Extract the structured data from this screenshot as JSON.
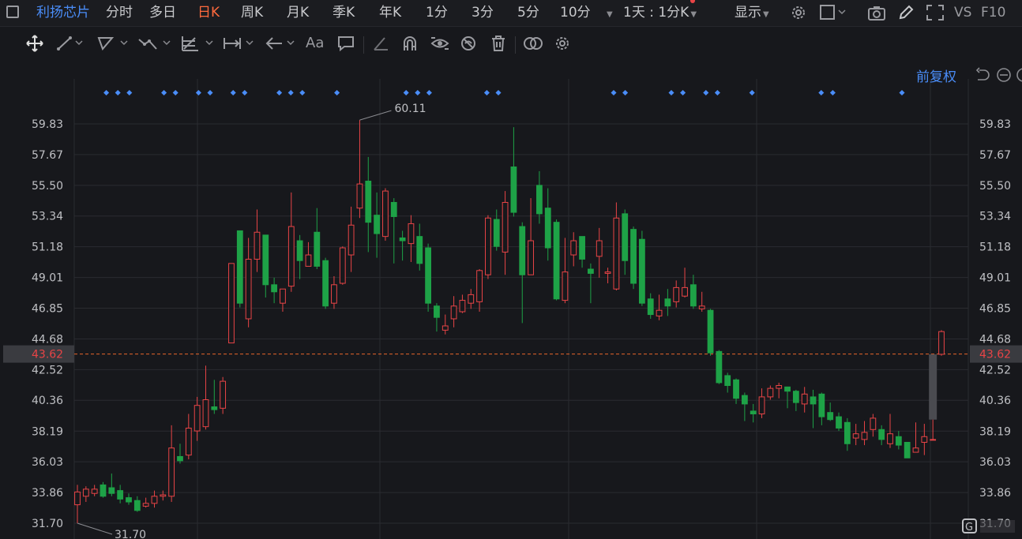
{
  "header": {
    "stock_name": "利扬芯片",
    "periods": [
      {
        "label": "分时",
        "active": false
      },
      {
        "label": "多日",
        "active": false
      },
      {
        "label": "日K",
        "active": true
      },
      {
        "label": "周K",
        "active": false
      },
      {
        "label": "月K",
        "active": false
      },
      {
        "label": "季K",
        "active": false
      },
      {
        "label": "年K",
        "active": false
      },
      {
        "label": "1分",
        "active": false
      },
      {
        "label": "3分",
        "active": false
      },
      {
        "label": "5分",
        "active": false
      },
      {
        "label": "10分",
        "active": false
      }
    ],
    "interval_select": "1天 : 1分K",
    "display_label": "显示",
    "vs_label": "VS",
    "f10_label": "F10"
  },
  "toolbar": {
    "text_tool_label": "Aa",
    "icons": [
      "move-icon",
      "line-icon",
      "polyline-icon",
      "wave-icon",
      "fibonacci-icon",
      "measure-icon",
      "arrow-icon",
      "text-icon",
      "comment-icon",
      "ruler-icon",
      "magnet-icon",
      "eye-icon",
      "hide-icon",
      "trash-icon",
      "link-icon",
      "gear-icon"
    ]
  },
  "chart_data": {
    "type": "candlestick",
    "adjust_mode": "前复权",
    "y_ticks": [
      "59.83",
      "57.67",
      "55.50",
      "53.34",
      "51.18",
      "49.01",
      "46.85",
      "44.68",
      "43.62",
      "42.52",
      "40.36",
      "38.19",
      "36.03",
      "33.86",
      "31.70"
    ],
    "last_price": "43.62",
    "high_label": "60.11",
    "low_label": "31.70",
    "ylim": [
      31.7,
      59.83
    ],
    "colors": {
      "up": "#e84446",
      "down": "#1ea247",
      "grid": "#2a2b30",
      "bg": "#17181c",
      "marker": "#4a8df8",
      "last_price": "#e8642b"
    },
    "candles": [
      [
        33.0,
        33.9,
        34.4,
        31.7
      ],
      [
        33.6,
        34.1,
        34.3,
        33.2
      ],
      [
        33.8,
        34.1,
        34.4,
        33.6
      ],
      [
        34.4,
        33.6,
        34.6,
        33.5
      ],
      [
        34.2,
        33.8,
        35.2,
        33.6
      ],
      [
        34.0,
        33.4,
        34.4,
        33.1
      ],
      [
        33.5,
        33.2,
        33.8,
        33.0
      ],
      [
        33.3,
        32.6,
        33.6,
        32.5
      ],
      [
        32.9,
        33.1,
        33.5,
        32.8
      ],
      [
        33.1,
        33.6,
        34.0,
        32.8
      ],
      [
        33.6,
        33.7,
        34.0,
        33.3
      ],
      [
        33.6,
        37.0,
        38.6,
        33.2
      ],
      [
        36.4,
        36.1,
        37.3,
        35.9
      ],
      [
        36.5,
        38.4,
        39.4,
        36.2
      ],
      [
        38.2,
        40.0,
        40.6,
        37.5
      ],
      [
        38.5,
        40.4,
        42.8,
        38.3
      ],
      [
        39.9,
        39.7,
        41.8,
        39.4
      ],
      [
        39.8,
        41.7,
        42.0,
        39.4
      ],
      [
        44.4,
        50.0,
        50.0,
        44.4
      ],
      [
        52.3,
        47.2,
        52.3,
        46.9
      ],
      [
        46.1,
        50.3,
        51.8,
        45.5
      ],
      [
        50.3,
        52.2,
        53.8,
        49.4
      ],
      [
        52.0,
        48.5,
        52.0,
        47.6
      ],
      [
        48.5,
        48.0,
        49.0,
        47.2
      ],
      [
        47.2,
        48.2,
        48.2,
        46.6
      ],
      [
        48.4,
        52.6,
        55.0,
        48.0
      ],
      [
        51.6,
        50.2,
        52.0,
        48.9
      ],
      [
        49.8,
        50.6,
        51.5,
        49.8
      ],
      [
        52.2,
        49.8,
        53.9,
        49.6
      ],
      [
        50.2,
        47.0,
        50.4,
        46.8
      ],
      [
        47.2,
        48.5,
        49.1,
        46.8
      ],
      [
        48.6,
        51.1,
        51.2,
        48.5
      ],
      [
        50.6,
        52.7,
        54.0,
        49.4
      ],
      [
        53.9,
        55.6,
        60.1,
        53.2
      ],
      [
        55.8,
        52.9,
        57.5,
        50.8
      ],
      [
        53.4,
        52.1,
        55.0,
        50.4
      ],
      [
        51.9,
        55.1,
        55.3,
        51.6
      ],
      [
        54.3,
        53.3,
        54.6,
        50.0
      ],
      [
        51.8,
        51.6,
        52.3,
        50.2
      ],
      [
        51.4,
        52.8,
        53.4,
        50.1
      ],
      [
        51.9,
        50.0,
        52.8,
        49.5
      ],
      [
        51.1,
        47.2,
        51.4,
        46.6
      ],
      [
        47.0,
        46.2,
        47.2,
        45.2
      ],
      [
        45.3,
        45.6,
        46.4,
        45.0
      ],
      [
        46.1,
        47.0,
        47.7,
        45.5
      ],
      [
        46.6,
        47.4,
        47.8,
        46.5
      ],
      [
        47.2,
        47.8,
        48.2,
        46.8
      ],
      [
        47.3,
        49.5,
        49.6,
        46.6
      ],
      [
        49.2,
        53.2,
        53.4,
        48.9
      ],
      [
        53.1,
        51.2,
        53.8,
        50.9
      ],
      [
        50.8,
        54.3,
        55.1,
        49.2
      ],
      [
        56.8,
        53.6,
        59.6,
        53.3
      ],
      [
        52.6,
        49.2,
        52.9,
        45.8
      ],
      [
        49.2,
        51.6,
        54.6,
        49.2
      ],
      [
        55.5,
        53.5,
        56.5,
        52.8
      ],
      [
        53.9,
        51.1,
        55.3,
        50.2
      ],
      [
        52.9,
        47.5,
        53.1,
        47.4
      ],
      [
        47.4,
        49.4,
        51.8,
        47.2
      ],
      [
        50.6,
        51.6,
        52.2,
        49.8
      ],
      [
        51.9,
        50.3,
        51.8,
        49.7
      ],
      [
        49.6,
        49.3,
        50.0,
        47.2
      ],
      [
        50.5,
        51.6,
        52.5,
        49.0
      ],
      [
        49.3,
        49.4,
        49.7,
        48.6
      ],
      [
        48.2,
        53.2,
        54.3,
        48.1
      ],
      [
        53.5,
        50.2,
        53.8,
        49.2
      ],
      [
        52.4,
        48.6,
        52.6,
        48.2
      ],
      [
        51.7,
        47.2,
        52.3,
        47.0
      ],
      [
        47.5,
        46.4,
        47.9,
        46.1
      ],
      [
        46.3,
        46.7,
        47.8,
        46.0
      ],
      [
        47.5,
        47.0,
        48.2,
        46.3
      ],
      [
        47.3,
        48.3,
        48.8,
        46.9
      ],
      [
        47.7,
        48.3,
        49.7,
        47.6
      ],
      [
        48.5,
        47.0,
        49.2,
        46.8
      ],
      [
        46.8,
        47.0,
        48.0,
        46.6
      ],
      [
        46.7,
        43.7,
        46.8,
        43.5
      ],
      [
        43.8,
        41.6,
        43.9,
        41.5
      ],
      [
        42.1,
        41.4,
        42.3,
        40.9
      ],
      [
        41.8,
        40.5,
        41.9,
        40.1
      ],
      [
        40.7,
        40.1,
        40.9,
        38.9
      ],
      [
        39.6,
        39.4,
        40.1,
        38.8
      ],
      [
        39.4,
        40.6,
        41.2,
        39.1
      ],
      [
        40.6,
        41.2,
        41.4,
        40.4
      ],
      [
        41.2,
        41.4,
        41.6,
        40.5
      ],
      [
        41.3,
        41.0,
        41.2,
        39.8
      ],
      [
        41.0,
        40.2,
        41.1,
        39.6
      ],
      [
        40.1,
        40.8,
        41.3,
        39.5
      ],
      [
        40.6,
        40.1,
        41.1,
        38.4
      ],
      [
        40.8,
        39.2,
        40.9,
        38.6
      ],
      [
        39.5,
        39.0,
        40.2,
        38.9
      ],
      [
        39.2,
        38.4,
        39.5,
        38.2
      ],
      [
        38.8,
        37.3,
        39.1,
        36.8
      ],
      [
        37.7,
        38.0,
        38.7,
        37.2
      ],
      [
        37.6,
        38.1,
        38.9,
        37.2
      ],
      [
        38.3,
        39.1,
        39.4,
        37.8
      ],
      [
        38.3,
        37.6,
        38.6,
        37.2
      ],
      [
        37.3,
        38.0,
        39.4,
        37.0
      ],
      [
        37.8,
        37.2,
        38.2,
        36.9
      ],
      [
        37.4,
        36.3,
        37.4,
        36.3
      ],
      [
        36.7,
        37.0,
        38.8,
        36.8
      ],
      [
        37.4,
        37.8,
        38.7,
        36.5
      ],
      [
        37.6,
        37.6,
        39.0,
        37.6
      ],
      [
        43.6,
        45.2,
        45.3,
        43.5
      ]
    ],
    "markers_x": [
      1,
      2,
      3,
      6,
      7,
      9,
      10,
      12,
      13,
      16,
      17,
      18,
      21,
      27,
      28,
      29,
      34,
      35,
      45,
      46,
      50,
      51,
      53,
      54,
      57,
      63,
      64,
      70
    ],
    "last_vol_bar": {
      "from": 43.6,
      "to": 39.0
    }
  }
}
